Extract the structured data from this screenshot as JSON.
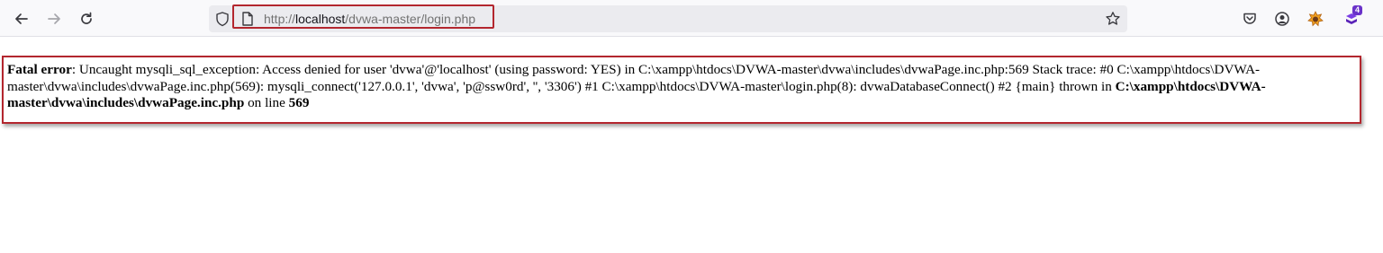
{
  "browser": {
    "url_scheme": "http://",
    "url_host": "localhost",
    "url_path": "/dvwa-master/login.php",
    "extension_badge": "4",
    "icons": [
      "back-icon",
      "forward-icon",
      "reload-icon",
      "shield-icon",
      "page-icon",
      "bookmark-star-icon",
      "pocket-icon",
      "account-icon",
      "extension-icon",
      "extension-badge-icon"
    ]
  },
  "error": {
    "label": "Fatal error",
    "message": ": Uncaught mysqli_sql_exception: Access denied for user 'dvwa'@'localhost' (using password: YES) in C:\\xampp\\htdocs\\DVWA-master\\dvwa\\includes\\dvwaPage.inc.php:569 Stack trace: #0 C:\\xampp\\htdocs\\DVWA-master\\dvwa\\includes\\dvwaPage.inc.php(569): mysqli_connect('127.0.0.1', 'dvwa', 'p@ssw0rd', '', '3306') #1 C:\\xampp\\htdocs\\DVWA-master\\login.php(8): dvwaDatabaseConnect() #2 {main} thrown in ",
    "file": "C:\\xampp\\htdocs\\DVWA-master\\dvwa\\includes\\dvwaPage.inc.php",
    "line_prefix": " on line ",
    "line": "569"
  },
  "colors": {
    "annotation": "#b3262e",
    "toolbar_bg": "#f9f9fb",
    "urlbar_bg": "#ebebef"
  }
}
